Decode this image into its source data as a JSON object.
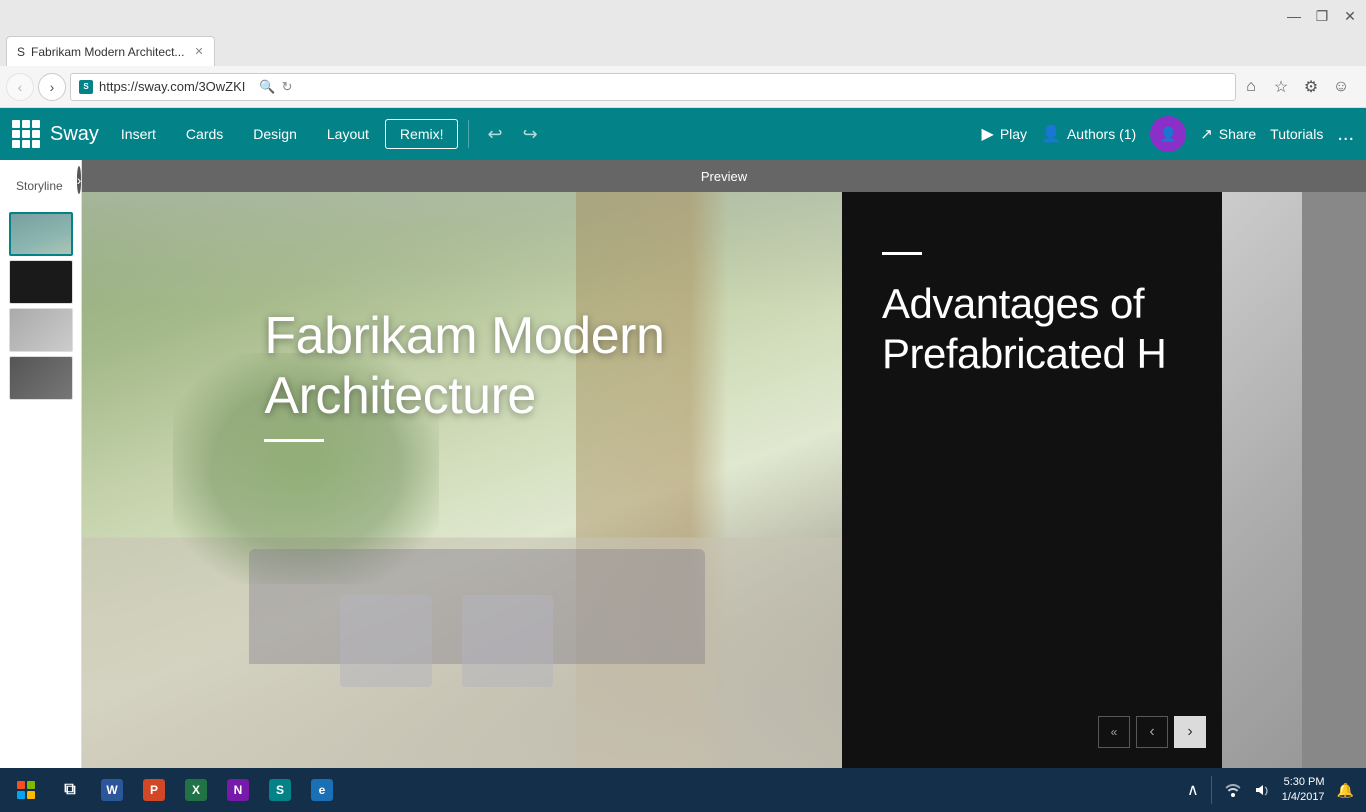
{
  "browser": {
    "title_bar": {
      "minimize": "—",
      "maximize": "❐",
      "close": "✕"
    },
    "nav": {
      "back": "‹",
      "forward": "›",
      "refresh": "↻"
    },
    "address": "https://sway.com/3OwZKI",
    "tab_title": "Fabrikam Modern Architect...",
    "favicon_letter": "S"
  },
  "toolbar_icons": {
    "home": "⌂",
    "star": "☆",
    "gear": "⚙",
    "emoji": "☺"
  },
  "sway": {
    "app_name": "Sway",
    "menu": {
      "insert": "Insert",
      "cards": "Cards",
      "design": "Design",
      "layout": "Layout",
      "remix": "Remix!"
    },
    "undo": "↩",
    "redo": "↪",
    "right_actions": {
      "play": "Play",
      "authors": "Authors (1)",
      "share": "Share",
      "tutorials": "Tutorials",
      "more": "..."
    }
  },
  "storyline": {
    "label": "Storyline",
    "chevron": "›"
  },
  "preview": {
    "label": "Preview"
  },
  "slides": {
    "slide1": {
      "title_line1": "Fabrikam Modern",
      "title_line2": "Architecture"
    },
    "slide2": {
      "title": "Advantages of Prefabricated H"
    }
  },
  "nav_arrows": {
    "first": "«",
    "prev": "‹",
    "next": "›"
  },
  "taskbar": {
    "time": "5:30 PM",
    "date": "1/4/2017",
    "apps": [
      {
        "name": "Word",
        "letter": "W",
        "color": "#2b579a"
      },
      {
        "name": "PowerPoint",
        "letter": "P",
        "color": "#d24726"
      },
      {
        "name": "Excel",
        "letter": "X",
        "color": "#217346"
      },
      {
        "name": "OneNote",
        "letter": "N",
        "color": "#7719aa"
      },
      {
        "name": "Sway",
        "letter": "S",
        "color": "#038387"
      },
      {
        "name": "Internet Explorer",
        "letter": "e",
        "color": "#1a6fb5"
      }
    ]
  }
}
